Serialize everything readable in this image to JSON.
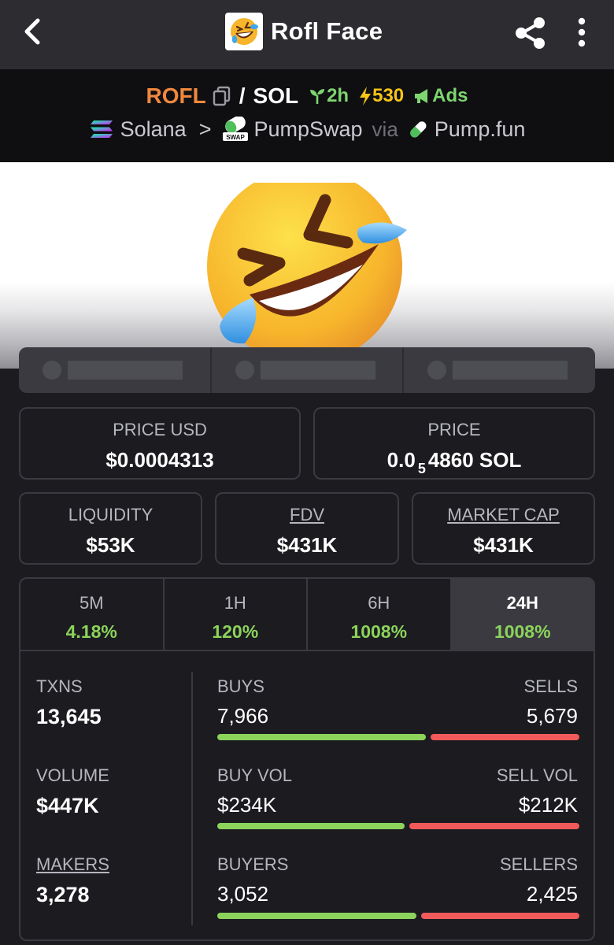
{
  "header": {
    "title": "Rofl Face"
  },
  "pair": {
    "base": "ROFL",
    "slash": "/",
    "quote": "SOL",
    "age": "2h",
    "boosts": "530",
    "ads": "Ads",
    "chain": "Solana",
    "dex": "PumpSwap",
    "via": "via",
    "launchpad": "Pump.fun",
    "dex_badge": "SWAP"
  },
  "stats": {
    "price_usd_label": "PRICE USD",
    "price_usd": "$0.0004313",
    "price_label": "PRICE",
    "price_prefix": "0.0",
    "price_zeros": "5",
    "price_suffix": "4860 SOL",
    "liquidity_label": "LIQUIDITY",
    "liquidity": "$53K",
    "fdv_label": "FDV",
    "fdv": "$431K",
    "mcap_label": "MARKET CAP",
    "mcap": "$431K"
  },
  "timeframes": [
    {
      "label": "5M",
      "change": "4.18%"
    },
    {
      "label": "1H",
      "change": "120%"
    },
    {
      "label": "6H",
      "change": "1008%"
    },
    {
      "label": "24H",
      "change": "1008%"
    }
  ],
  "active_timeframe": "24H",
  "txn": {
    "txns_label": "TXNS",
    "txns": "13,645",
    "buys_label": "BUYS",
    "buys": "7,966",
    "sells_label": "SELLS",
    "sells": "5,679",
    "buys_ratio": 0.584,
    "volume_label": "VOLUME",
    "volume": "$447K",
    "buy_vol_label": "BUY VOL",
    "buy_vol": "$234K",
    "sell_vol_label": "SELL VOL",
    "sell_vol": "$212K",
    "buy_vol_ratio": 0.524,
    "makers_label": "MAKERS",
    "makers": "3,278",
    "buyers_label": "BUYERS",
    "buyers": "3,052",
    "sellers_label": "SELLERS",
    "sellers": "2,425",
    "buyers_ratio": 0.557
  },
  "colors": {
    "accent_orange": "#f0883e",
    "positive_green": "#8cd35b",
    "negative_red": "#f05a5a",
    "boost_yellow": "#f5c518"
  }
}
